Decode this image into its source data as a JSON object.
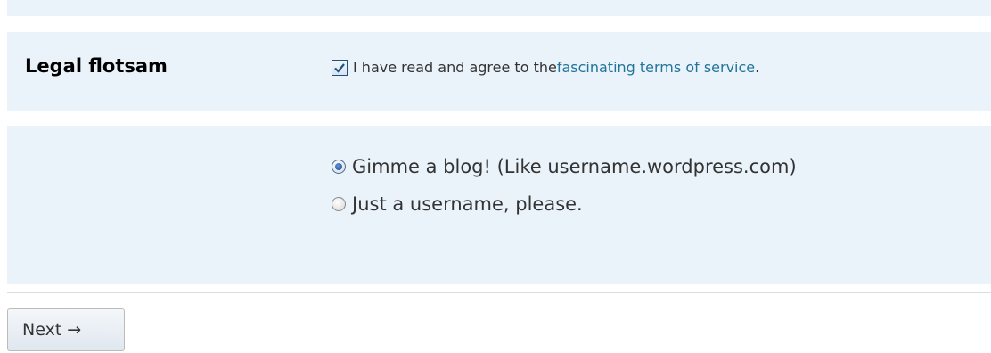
{
  "legal": {
    "label": "Legal flotsam",
    "agree_prefix": "I have read and agree to the ",
    "terms_link": "fascinating terms of service",
    "agree_suffix": ".",
    "checked": true
  },
  "signup_choice": {
    "options": [
      {
        "label": "Gimme a blog! (Like username.wordpress.com)",
        "selected": true
      },
      {
        "label": "Just a username, please.",
        "selected": false
      }
    ]
  },
  "actions": {
    "next_label": "Next →"
  },
  "colors": {
    "row_background": "#eaf2fa",
    "link": "#21759b"
  }
}
